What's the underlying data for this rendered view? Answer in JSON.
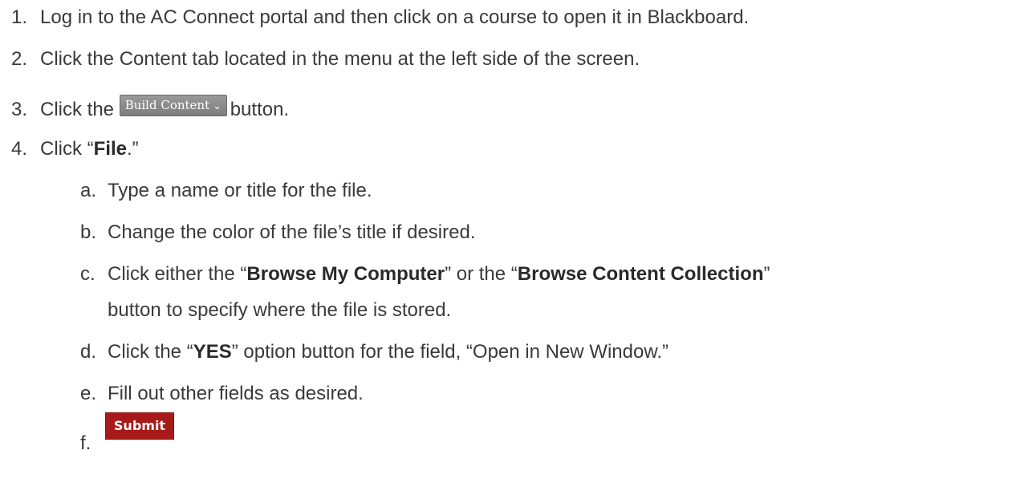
{
  "steps": [
    {
      "num": "1.",
      "text": "Log in to the AC Connect portal and then click on a course to open it in Blackboard."
    },
    {
      "num": "2.",
      "text": "Click the Content tab located in the menu at the left side of the screen."
    },
    {
      "num": "3.",
      "pre": "Click the",
      "button": "Build Content",
      "post": "button."
    },
    {
      "num": "4.",
      "pre": "Click “",
      "bold": "File",
      "post": ".”"
    }
  ],
  "substeps": {
    "a": {
      "num": "a.",
      "text": "Type a name or title for the file."
    },
    "b": {
      "num": "b.",
      "text": "Change the color of the file’s title if desired."
    },
    "c": {
      "num": "c.",
      "t1": "Click either the “",
      "b1": "Browse My Computer",
      "t2": "” or the “",
      "b2": "Browse Content Collection",
      "t3": "”",
      "line2": "button to specify where the file is stored."
    },
    "d": {
      "num": "d.",
      "t1": "Click the “",
      "b1": "YES",
      "t2": "” option button for the field, “Open in New Window.”"
    },
    "e": {
      "num": "e.",
      "text": "Fill out other fields as desired."
    },
    "f": {
      "num": "f.",
      "button": "Submit"
    }
  },
  "icons": {
    "build_chevron": "chevron-down-icon"
  },
  "colors": {
    "build_button": "#888888",
    "submit_button": "#a81a1a",
    "text": "#3a3a3a"
  }
}
